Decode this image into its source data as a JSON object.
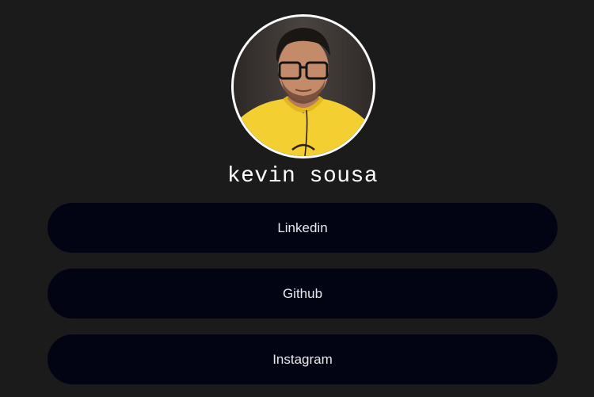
{
  "profile": {
    "name": "kevin sousa",
    "avatar_icon": "profile-photo"
  },
  "links": [
    {
      "label": "Linkedin"
    },
    {
      "label": "Github"
    },
    {
      "label": "Instagram"
    }
  ],
  "colors": {
    "background": "#1b1b1c",
    "button": "#020414",
    "text": "#ffffff",
    "avatar_border": "#ffffff"
  }
}
